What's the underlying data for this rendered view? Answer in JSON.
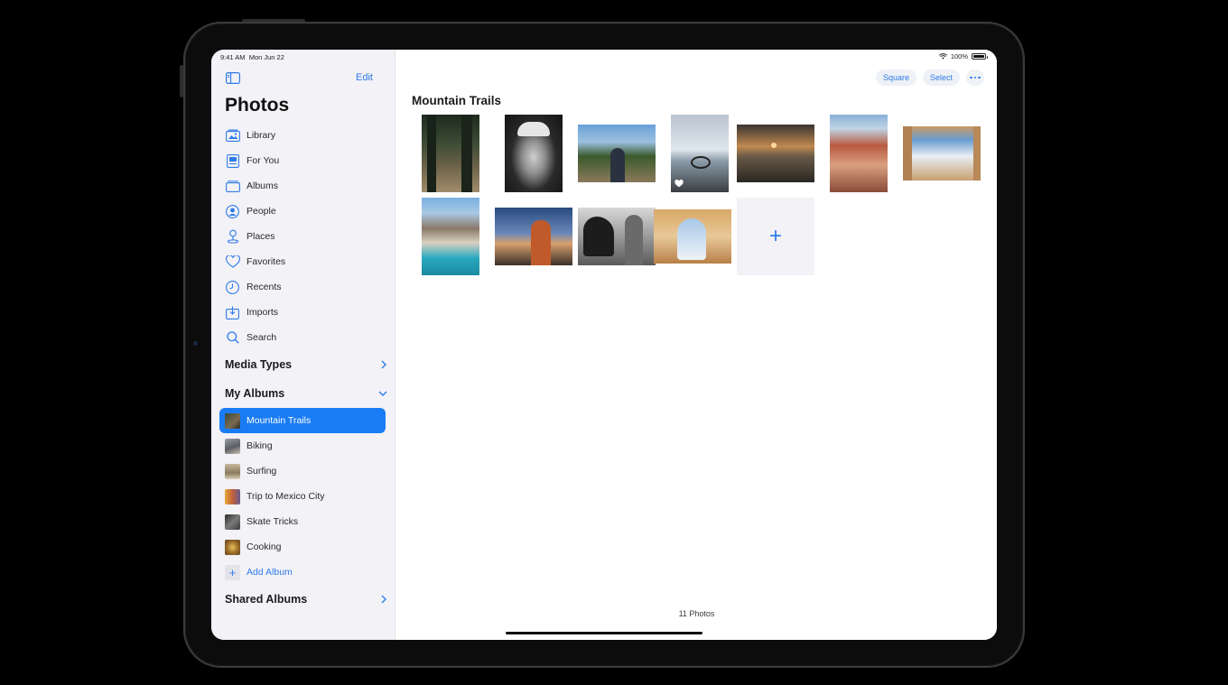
{
  "status": {
    "time": "9:41 AM",
    "date": "Mon Jun 22",
    "battery": "100%"
  },
  "sidebar": {
    "edit_label": "Edit",
    "title": "Photos",
    "items": [
      {
        "label": "Library",
        "icon": "library-icon"
      },
      {
        "label": "For You",
        "icon": "for-you-icon"
      },
      {
        "label": "Albums",
        "icon": "albums-icon"
      },
      {
        "label": "People",
        "icon": "people-icon"
      },
      {
        "label": "Places",
        "icon": "places-icon"
      },
      {
        "label": "Favorites",
        "icon": "heart-icon"
      },
      {
        "label": "Recents",
        "icon": "clock-icon"
      },
      {
        "label": "Imports",
        "icon": "import-icon"
      },
      {
        "label": "Search",
        "icon": "search-icon"
      }
    ],
    "media_types_label": "Media Types",
    "my_albums_label": "My Albums",
    "albums": [
      {
        "label": "Mountain Trails",
        "selected": true
      },
      {
        "label": "Biking"
      },
      {
        "label": "Surfing"
      },
      {
        "label": "Trip to Mexico City"
      },
      {
        "label": "Skate Tricks"
      },
      {
        "label": "Cooking"
      }
    ],
    "add_album_label": "Add Album",
    "shared_albums_label": "Shared Albums"
  },
  "toolbar": {
    "square_label": "Square",
    "select_label": "Select"
  },
  "album": {
    "title": "Mountain Trails",
    "count_label": "11 Photos"
  },
  "colors": {
    "accent": "#2f7be8",
    "selected": "#1a7cf5",
    "sidebar_bg": "#f2f2f7"
  }
}
